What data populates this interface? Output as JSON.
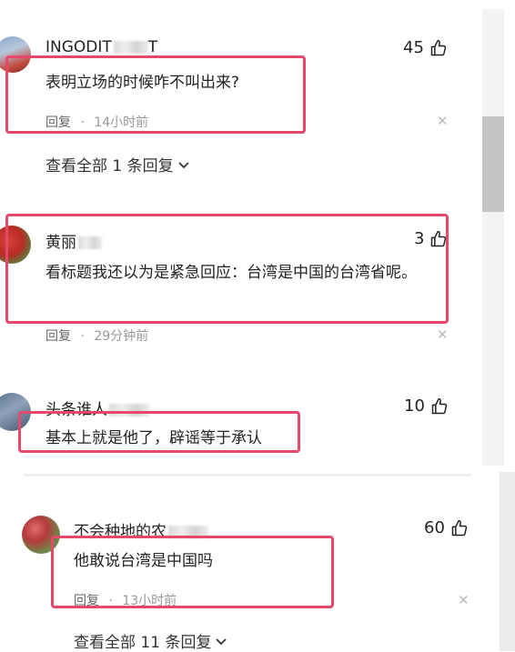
{
  "comments": [
    {
      "username": "INGODIT",
      "username_tail": "T",
      "likes": "45",
      "text": "表明立场的时候咋不叫出来?",
      "reply_label": "回复",
      "time": "14小时前",
      "view_replies": "查看全部 1 条回复"
    },
    {
      "username": "黄丽",
      "likes": "3",
      "text": "看标题我还以为是紧急回应：台湾是中国的台湾省呢。",
      "reply_label": "回复",
      "time": "29分钟前"
    },
    {
      "username": "头条谁人",
      "likes": "10",
      "text": "基本上就是他了，辟谣等于承认"
    },
    {
      "username": "不会种地的农",
      "likes": "60",
      "text": "他敢说台湾是中国吗",
      "reply_label": "回复",
      "time": "13小时前",
      "view_replies": "查看全部 11 条回复"
    }
  ],
  "separator_dot": "·",
  "highlight_color": "#e4486a"
}
